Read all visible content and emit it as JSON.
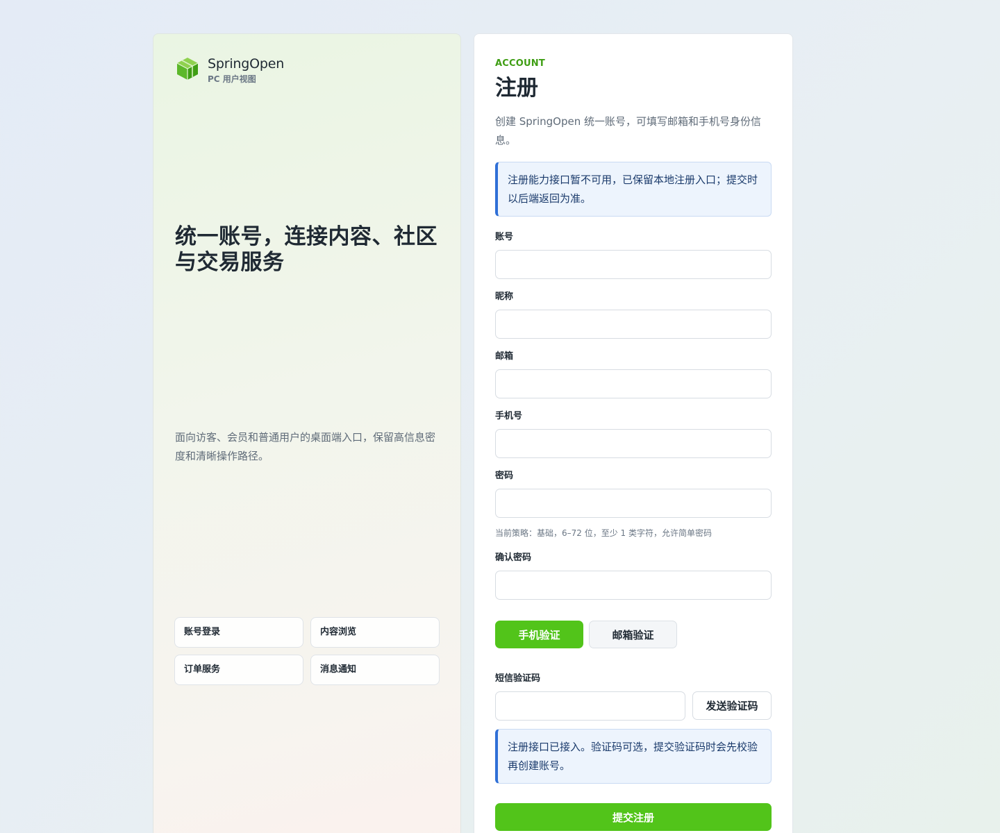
{
  "brand": {
    "name": "SpringOpen",
    "subtitle": "PC 用户视图",
    "logo_icon": "cube-icon",
    "accent_color": "#52c41a"
  },
  "hero": {
    "title": "统一账号，连接内容、社区与交易服务",
    "description": "面向访客、会员和普通用户的桌面端入口，保留高信息密度和清晰操作路径。",
    "features": [
      "账号登录",
      "内容浏览",
      "订单服务",
      "消息通知"
    ]
  },
  "form": {
    "eyebrow": "ACCOUNT",
    "title": "注册",
    "subtitle": "创建 SpringOpen 统一账号，可填写邮箱和手机号身份信息。",
    "notice_top": "注册能力接口暂不可用，已保留本地注册入口；提交时以后端返回为准。",
    "fields": {
      "account": {
        "label": "账号",
        "value": ""
      },
      "nickname": {
        "label": "昵称",
        "value": ""
      },
      "email": {
        "label": "邮箱",
        "value": ""
      },
      "phone": {
        "label": "手机号",
        "value": ""
      },
      "password": {
        "label": "密码",
        "value": ""
      },
      "confirm_password": {
        "label": "确认密码",
        "value": ""
      },
      "sms_code": {
        "label": "短信验证码",
        "value": ""
      }
    },
    "password_hint": "当前策略：基础，6–72 位，至少 1 类字符，允许简单密码",
    "verify_tabs": {
      "phone": "手机验证",
      "email": "邮箱验证",
      "active": "phone"
    },
    "send_code_label": "发送验证码",
    "notice_bottom": "注册接口已接入。验证码可选，提交验证码时会先校验再创建账号。",
    "submit_label": "提交注册"
  }
}
